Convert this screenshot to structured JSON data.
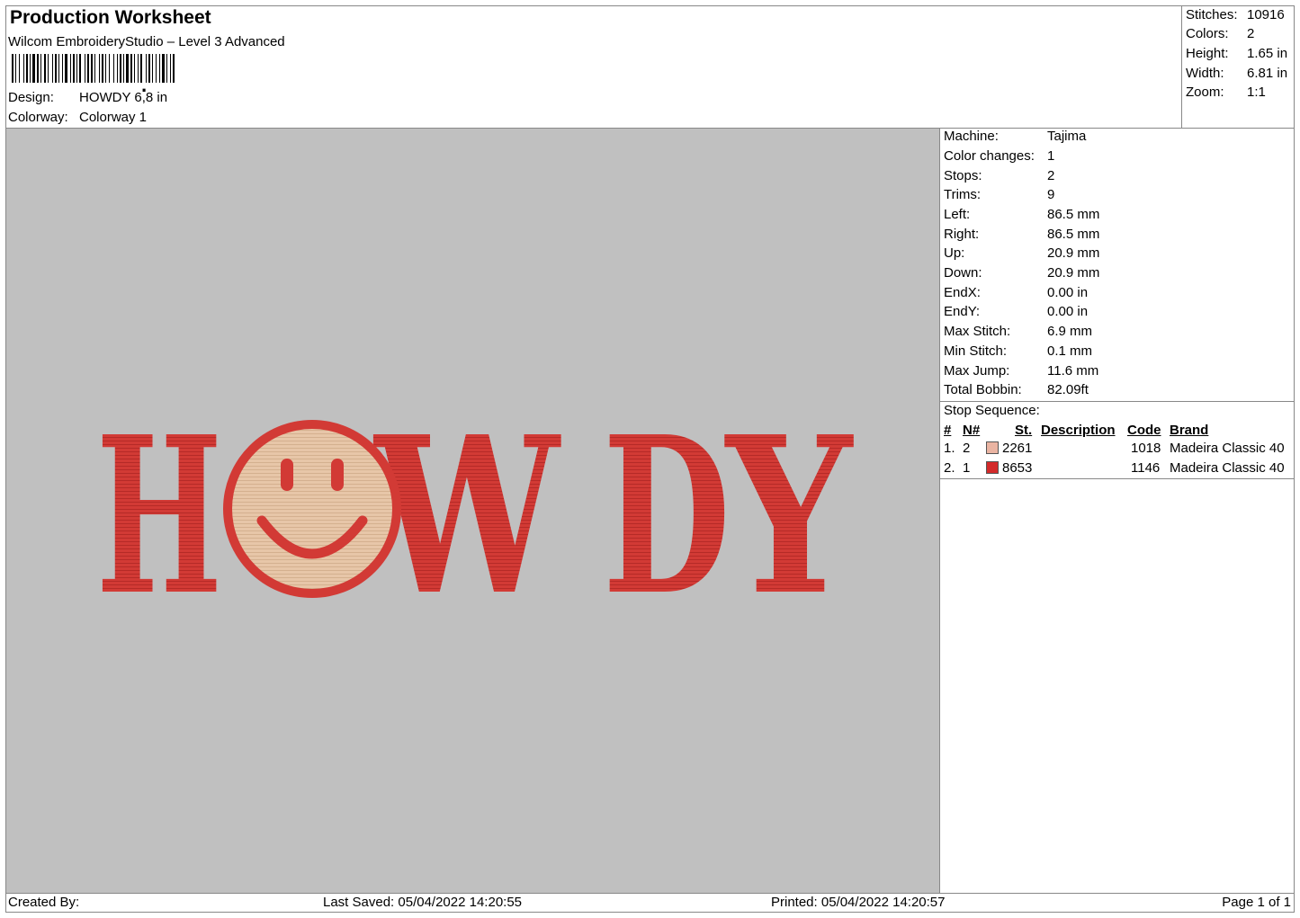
{
  "header": {
    "title": "Production Worksheet",
    "subtitle": "Wilcom EmbroideryStudio – Level 3 Advanced",
    "design_label": "Design:",
    "design_value": "HOWDY 6,8 in",
    "colorway_label": "Colorway:",
    "colorway_value": "Colorway 1"
  },
  "stats": {
    "stitches_label": "Stitches:",
    "stitches_value": "10916",
    "colors_label": "Colors:",
    "colors_value": "2",
    "height_label": "Height:",
    "height_value": "1.65 in",
    "width_label": "Width:",
    "width_value": "6.81 in",
    "zoom_label": "Zoom:",
    "zoom_value": "1:1"
  },
  "design": {
    "letters": [
      "H",
      "W",
      "D",
      "Y"
    ],
    "thread_red": "#d23a35",
    "thread_tan": "#e7c6a8",
    "background": "#c0c0c0"
  },
  "machine_info": {
    "machine_label": "Machine:",
    "machine_value": "Tajima",
    "color_changes_label": "Color changes:",
    "color_changes_value": "1",
    "stops_label": "Stops:",
    "stops_value": "2",
    "trims_label": "Trims:",
    "trims_value": "9",
    "left_label": "Left:",
    "left_value": "86.5 mm",
    "right_label": "Right:",
    "right_value": "86.5 mm",
    "up_label": "Up:",
    "up_value": "20.9 mm",
    "down_label": "Down:",
    "down_value": "20.9 mm",
    "endx_label": "EndX:",
    "endx_value": "0.00 in",
    "endy_label": "EndY:",
    "endy_value": "0.00 in",
    "max_stitch_label": "Max Stitch:",
    "max_stitch_value": "6.9 mm",
    "min_stitch_label": "Min Stitch:",
    "min_stitch_value": "0.1 mm",
    "max_jump_label": "Max Jump:",
    "max_jump_value": "11.6 mm",
    "total_bobbin_label": "Total Bobbin:",
    "total_bobbin_value": "82.09ft"
  },
  "stop_sequence": {
    "title": "Stop Sequence:",
    "columns": {
      "num": "#",
      "n": "N#",
      "st": "St.",
      "description": "Description",
      "code": "Code",
      "brand": "Brand"
    },
    "rows": [
      {
        "num": "1.",
        "n": "2",
        "color": "#eab4a2",
        "st": "2261",
        "code": "1018",
        "brand": "Madeira Classic 40"
      },
      {
        "num": "2.",
        "n": "1",
        "color": "#d32a2a",
        "st": "8653",
        "code": "1146",
        "brand": "Madeira Classic 40"
      }
    ]
  },
  "footer": {
    "created_by": "Created By:",
    "last_saved": "Last Saved: 05/04/2022 14:20:55",
    "printed": "Printed: 05/04/2022 14:20:57",
    "page": "Page 1 of 1"
  }
}
